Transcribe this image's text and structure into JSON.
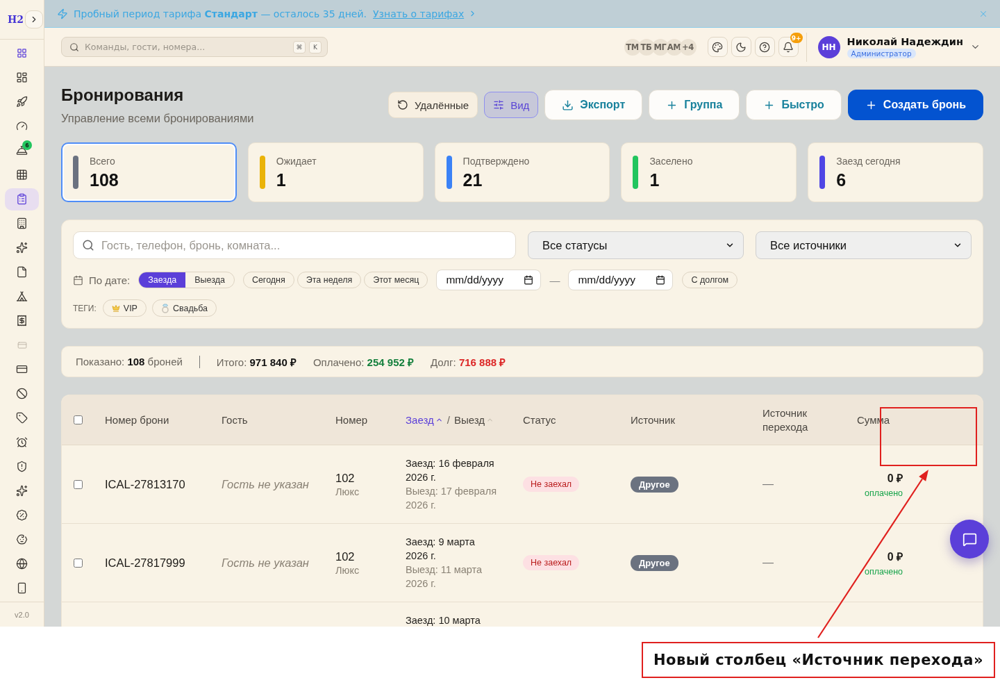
{
  "sidebar": {
    "logo": "H2",
    "items": [
      {
        "selected": false,
        "disabled": false
      },
      {
        "selected": false,
        "disabled": false
      },
      {
        "selected": false,
        "disabled": false
      },
      {
        "selected": false,
        "disabled": false,
        "badge": "6"
      },
      {
        "selected": false,
        "disabled": false
      },
      {
        "selected": true,
        "disabled": false
      },
      {
        "selected": false,
        "disabled": false
      },
      {
        "selected": false,
        "disabled": false
      },
      {
        "selected": false,
        "disabled": false
      },
      {
        "selected": false,
        "disabled": false
      },
      {
        "selected": false,
        "disabled": false
      },
      {
        "selected": false,
        "disabled": true
      },
      {
        "selected": false,
        "disabled": false
      },
      {
        "selected": false,
        "disabled": false
      },
      {
        "selected": false,
        "disabled": false
      },
      {
        "selected": false,
        "disabled": false
      },
      {
        "selected": false,
        "disabled": false
      },
      {
        "selected": false,
        "disabled": false
      },
      {
        "selected": false,
        "disabled": false
      },
      {
        "selected": false,
        "disabled": false
      },
      {
        "selected": false,
        "disabled": false
      },
      {
        "selected": false,
        "disabled": false
      }
    ],
    "version": "v2.0"
  },
  "banner": {
    "text": "Пробный период тарифа **Стандарт** — осталось 35 дней.",
    "link": "Узнать о тарифах"
  },
  "topbar": {
    "search": {
      "placeholder": "Команды, гости, номера...",
      "shortcut": [
        "⌘",
        "K"
      ]
    },
    "team": [
      "ТМ",
      "ТБ",
      "МГ",
      "АМ",
      "+4"
    ],
    "notifications_badge": "9+",
    "user": {
      "initials": "НН",
      "name": "Николай Надеждин",
      "role": "Администратор"
    }
  },
  "page": {
    "title": "Бронирования",
    "subtitle": "Управление всеми бронированиями",
    "actions": [
      {
        "label": "Удалённые",
        "kind": "muted"
      },
      {
        "label": "Вид",
        "kind": "active"
      },
      {
        "label": "Экспорт",
        "kind": "outline"
      },
      {
        "label": "Группа",
        "kind": "outline"
      },
      {
        "label": "Быстро",
        "kind": "outline"
      },
      {
        "label": "Создать бронь",
        "kind": "primary"
      }
    ]
  },
  "stats": [
    {
      "label": "Всего",
      "value": "108",
      "color": "#6b7280",
      "selected": true
    },
    {
      "label": "Ожидает",
      "value": "1",
      "color": "#eab308",
      "selected": false
    },
    {
      "label": "Подтверждено",
      "value": "21",
      "color": "#3b82f6",
      "selected": false
    },
    {
      "label": "Заселено",
      "value": "1",
      "color": "#22c55e",
      "selected": false
    },
    {
      "label": "Заезд сегодня",
      "value": "6",
      "color": "#4f46e5",
      "selected": false
    }
  ],
  "filters": {
    "search": {
      "placeholder": "Гость, телефон, бронь, комната..."
    },
    "status_select": {
      "value": "Все статусы"
    },
    "source_select": {
      "value": "Все источники"
    },
    "date_label": "По дате:",
    "date_modes": [
      {
        "label": "Заезда",
        "selected": true
      },
      {
        "label": "Выезда",
        "selected": false
      }
    ],
    "presets": [
      {
        "label": "Сегодня",
        "selected": false
      },
      {
        "label": "Эта неделя",
        "selected": false
      },
      {
        "label": "Этот месяц",
        "selected": false
      }
    ],
    "date_from": {
      "placeholder": "mm/dd/yyyy"
    },
    "date_separator": "—",
    "date_to": {
      "placeholder": "mm/dd/yyyy"
    },
    "debt_chip": {
      "label": "С долгом",
      "selected": false
    },
    "tags_label": "ТЕГИ:",
    "tags": [
      {
        "label": "VIP",
        "selected": false
      },
      {
        "label": "Свадьба",
        "selected": false
      }
    ]
  },
  "summary": [
    {
      "kind": "count",
      "text": "Показано: **108** броней"
    },
    {
      "kind": "total",
      "text": "Итого: **971 840 ₽**"
    },
    {
      "kind": "paid",
      "text": "Оплачено: **254 952 ₽**"
    },
    {
      "kind": "debt",
      "text": "Долг: **716 888 ₽**"
    }
  ],
  "table": {
    "select_all": {
      "checked": false
    },
    "columns": [
      {
        "kind": "text",
        "label": "Номер брони"
      },
      {
        "kind": "text",
        "label": "Гость"
      },
      {
        "kind": "text",
        "label": "Номер"
      },
      {
        "kind": "sort-pair",
        "separator": "/",
        "parts": [
          {
            "label": "Заезд",
            "sorted": true
          },
          {
            "label": "Выезд",
            "sorted": false
          }
        ]
      },
      {
        "kind": "text",
        "label": "Статус"
      },
      {
        "kind": "text",
        "label": "Источник"
      },
      {
        "kind": "text",
        "label": "Источник перехода"
      },
      {
        "kind": "text",
        "label": "Сумма"
      }
    ],
    "rows": [
      {
        "checked": false,
        "booking": "ICAL-27813170",
        "guest": "Гость не указан",
        "room": "102",
        "room_type": "Люкс",
        "checkin": "Заезд: 16 февраля 2026 г.",
        "checkout": "Выезд: 17 февраля 2026 г.",
        "status": "Не заехал",
        "source": "Другое",
        "referrer": "—",
        "amount": "0 ₽",
        "payment": "оплачено"
      },
      {
        "checked": false,
        "booking": "ICAL-27817999",
        "guest": "Гость не указан",
        "room": "102",
        "room_type": "Люкс",
        "checkin": "Заезд: 9 марта 2026 г.",
        "checkout": "Выезд: 11 марта 2026 г.",
        "status": "Не заехал",
        "source": "Другое",
        "referrer": "—",
        "amount": "0 ₽",
        "payment": "оплачено"
      },
      {
        "checkin": "Заезд: 10 марта"
      }
    ]
  },
  "annotation": {
    "callout": "Новый столбец «Источник перехода»"
  }
}
